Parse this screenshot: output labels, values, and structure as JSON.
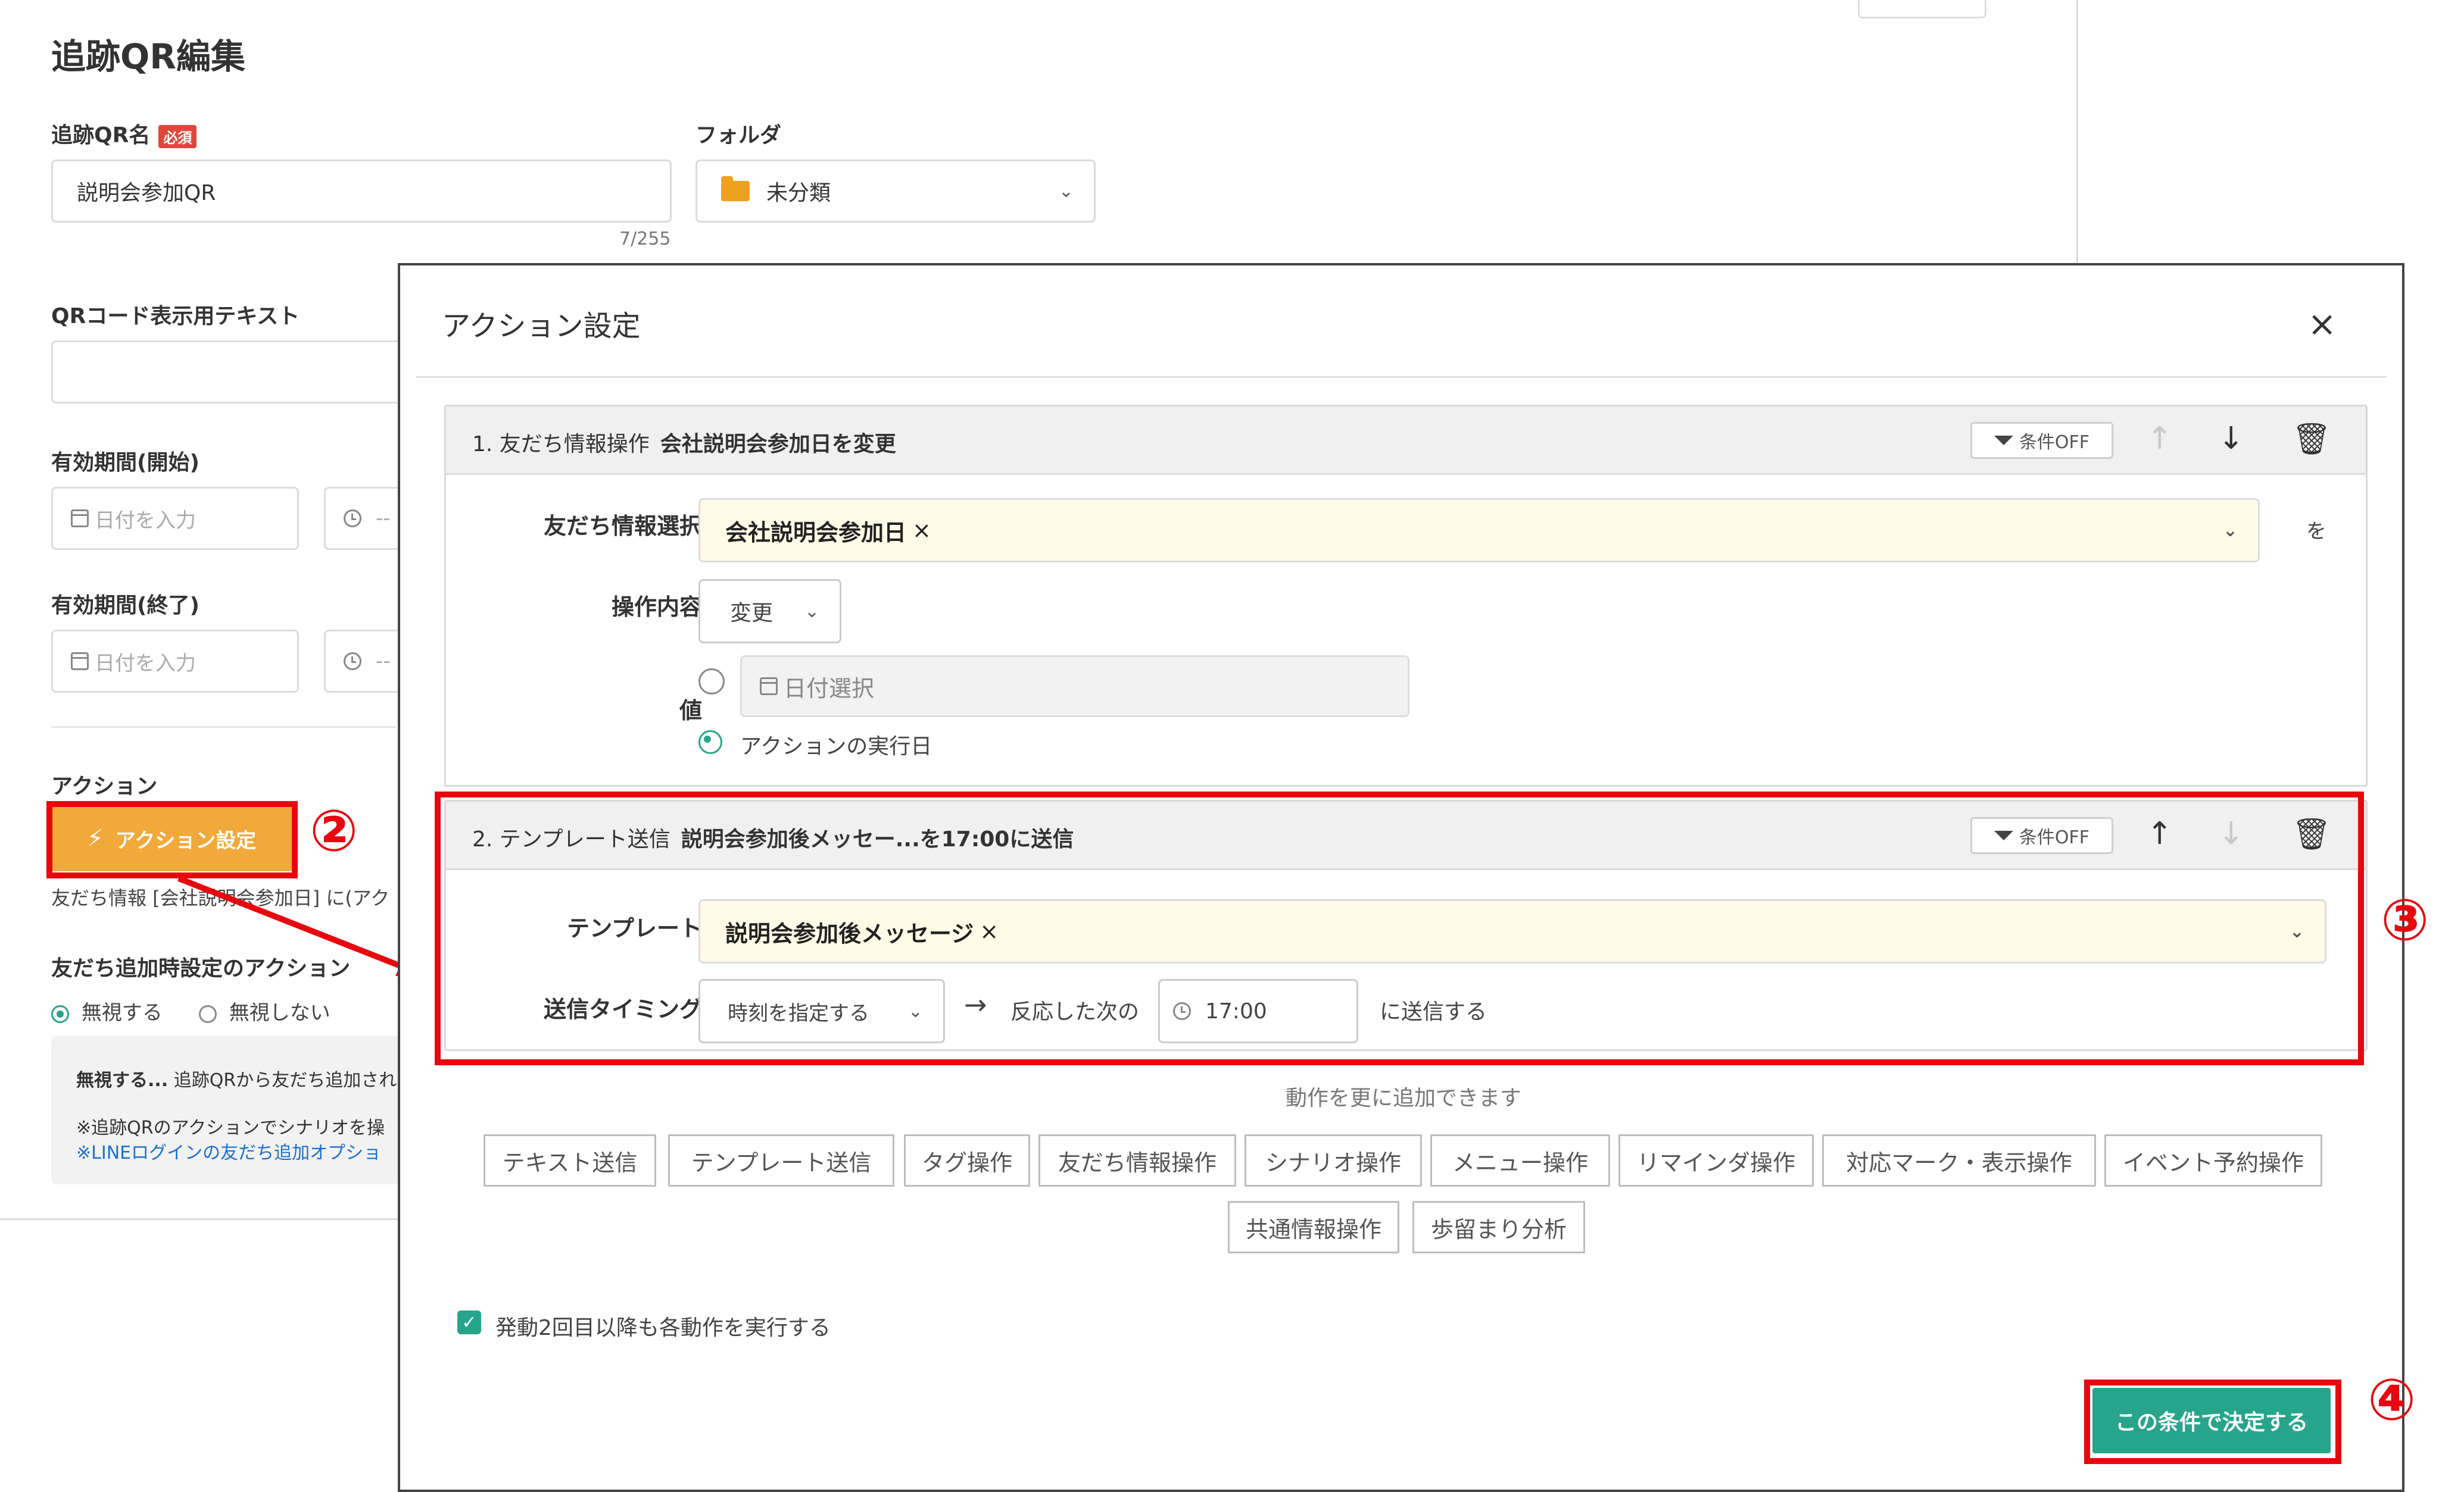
{
  "page": {
    "title": "追跡QR編集",
    "name_label": "追跡QR名",
    "required_badge": "必須",
    "name_value": "説明会参加QR",
    "name_counter": "7/255",
    "folder_label": "フォルダ",
    "folder_value": "未分類",
    "qr_text_label": "QRコード表示用テキスト",
    "start_label": "有効期間(開始)",
    "end_label": "有効期間(終了)",
    "date_placeholder": "日付を入力",
    "time_placeholder": "--",
    "action_label": "アクション",
    "action_button": "アクション設定",
    "action_summary": "友だち情報 [会社説明会参加日] に(アク",
    "friend_add_label": "友だち追加時設定のアクション",
    "ignore_option": "無視する",
    "no_ignore_option": "無視しない",
    "note_line1_bold": "無視する...",
    "note_line1": " 追跡QRから友だち追加され",
    "note_line2": "※追跡QRのアクションでシナリオを操",
    "note_line3": "※LINEログインの友だち追加オプショ"
  },
  "markers": {
    "m2": "②",
    "m3": "③",
    "m4": "④"
  },
  "modal": {
    "title": "アクション設定",
    "close": "×",
    "condition_button": "条件OFF",
    "card1": {
      "num": "1. 友だち情報操作",
      "summary": "会社説明会参加日を変更",
      "field_label": "友だち情報選択",
      "field_value": "会社説明会参加日",
      "field_suffix": "を",
      "op_label": "操作内容",
      "op_value": "変更",
      "value_label": "値",
      "date_select": "日付選択",
      "exec_day": "アクションの実行日"
    },
    "card2": {
      "num": "2. テンプレート送信",
      "summary": "説明会参加後メッセー...を17:00に送信",
      "template_label": "テンプレート",
      "template_value": "説明会参加後メッセージ",
      "timing_label": "送信タイミング",
      "timing_value": "時刻を指定する",
      "arrow": "→",
      "next_text": "反応した次の",
      "time_value": "17:00",
      "send_text": "に送信する"
    },
    "add_title": "動作を更に追加できます",
    "add_buttons_row1": [
      "テキスト送信",
      "テンプレート送信",
      "タグ操作",
      "友だち情報操作",
      "シナリオ操作",
      "メニュー操作",
      "リマインダ操作",
      "対応マーク・表示操作",
      "イベント予約操作"
    ],
    "add_buttons_row2": [
      "共通情報操作",
      "歩留まり分析"
    ],
    "repeat_label": "発動2回目以降も各動作を実行する",
    "confirm_button": "この条件で決定する"
  },
  "colors": {
    "accent_green": "#27a58c",
    "action_orange": "#f2a93b",
    "highlight_red": "#e8070e",
    "selected_yellow": "#fffbe6"
  }
}
